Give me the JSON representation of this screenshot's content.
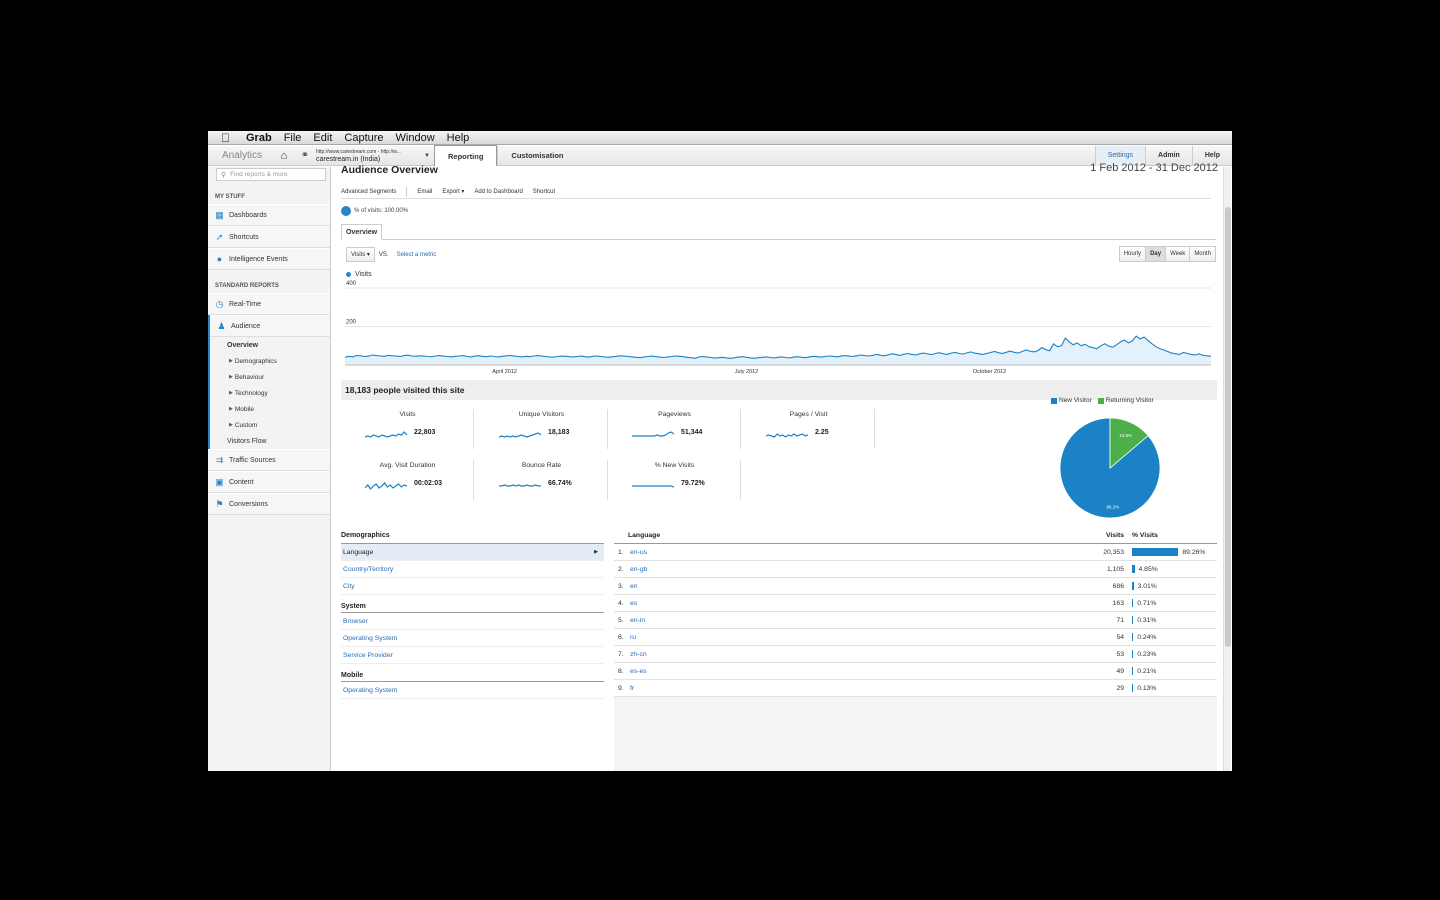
{
  "menubar": {
    "apple": "",
    "items": [
      "Grab",
      "File",
      "Edit",
      "Capture",
      "Window",
      "Help"
    ]
  },
  "header": {
    "brand": "Analytics",
    "account_url": "http://www.carestream.com - http://w...",
    "account_site": "carestream.in (India)",
    "tabs": [
      "Reporting",
      "Customisation"
    ],
    "right": [
      "Settings",
      "Admin",
      "Help"
    ]
  },
  "sidebar": {
    "search_placeholder": "Find reports & more",
    "my_stuff_heading": "MY STUFF",
    "my_stuff": [
      "Dashboards",
      "Shortcuts",
      "Intelligence Events"
    ],
    "standard_heading": "STANDARD REPORTS",
    "realtime": "Real-Time",
    "audience": "Audience",
    "audience_sub": [
      "Overview",
      "Demographics",
      "Behaviour",
      "Technology",
      "Mobile",
      "Custom",
      "Visitors Flow"
    ],
    "bottom": [
      "Traffic Sources",
      "Content",
      "Conversions"
    ]
  },
  "main": {
    "title": "Audience Overview",
    "date_range": "1 Feb 2012 - 31 Dec 2012",
    "toolbar": [
      "Advanced Segments",
      "Email",
      "Export ▾",
      "Add to Dashboard",
      "Shortcut"
    ],
    "segment_label": "% of visits: 100.00%",
    "tab": "Overview",
    "metric_select": "Visits",
    "vs": "VS.",
    "select_metric": "Select a metric",
    "granularity": [
      "Hourly",
      "Day",
      "Week",
      "Month"
    ],
    "legend": "Visits",
    "visited_text": "18,183 people visited this site"
  },
  "chart_data": {
    "type": "area",
    "series": [
      {
        "name": "Visits",
        "values": [
          40,
          45,
          42,
          50,
          48,
          44,
          46,
          52,
          49,
          47,
          45,
          50,
          48,
          46,
          44,
          49,
          51,
          47,
          45,
          48,
          46,
          44,
          43,
          47,
          49,
          46,
          44,
          42,
          45,
          47,
          49,
          44,
          42,
          46,
          48,
          45,
          43,
          47,
          44,
          42,
          45,
          48,
          50,
          46,
          44,
          42,
          45,
          43,
          47,
          49,
          46,
          44,
          42,
          41,
          44,
          46,
          45,
          43,
          42,
          44,
          46,
          43,
          41,
          45,
          47,
          44,
          42,
          40,
          43,
          45,
          48,
          46,
          44,
          42,
          40,
          38,
          42,
          44,
          46,
          43,
          41,
          39,
          42,
          44,
          47,
          45,
          43,
          40,
          38,
          35,
          42,
          44,
          41,
          39,
          36,
          38,
          40,
          37,
          35,
          38,
          41,
          43,
          40,
          37,
          35,
          38,
          40,
          42,
          39,
          37,
          40,
          42,
          39,
          37,
          41,
          43,
          40,
          38,
          42,
          45,
          43,
          41,
          44,
          47,
          45,
          42,
          46,
          49,
          46,
          44,
          48,
          52,
          49,
          47,
          50,
          55,
          51,
          48,
          53,
          58,
          54,
          50,
          56,
          60,
          55,
          52,
          58,
          62,
          57,
          54,
          60,
          64,
          58,
          55,
          62,
          66,
          60,
          57,
          63,
          68,
          62,
          58,
          55,
          60,
          65,
          70,
          64,
          60,
          66,
          72,
          66,
          62,
          70,
          78,
          72,
          68,
          75,
          90,
          80,
          74,
          110,
          95,
          100,
          140,
          120,
          105,
          115,
          100,
          108,
          95,
          90,
          85,
          100,
          110,
          98,
          92,
          105,
          120,
          130,
          115,
          125,
          150,
          135,
          145,
          128,
          110,
          95,
          85,
          78,
          70,
          62,
          58,
          55,
          65,
          60,
          55,
          52,
          58,
          50,
          48,
          45
        ]
      }
    ],
    "x_tick_labels": [
      "April 2012",
      "July 2012",
      "October 2012"
    ],
    "y_tick_labels": [
      "400",
      "200"
    ],
    "ylim": [
      0,
      400
    ],
    "grid": true
  },
  "metrics": [
    {
      "label": "Visits",
      "value": "22,803"
    },
    {
      "label": "Unique Visitors",
      "value": "18,183"
    },
    {
      "label": "Pageviews",
      "value": "51,344"
    },
    {
      "label": "Pages / Visit",
      "value": "2.25"
    },
    {
      "label": "Avg. Visit Duration",
      "value": "00:02:03"
    },
    {
      "label": "Bounce Rate",
      "value": "66.74%"
    },
    {
      "label": "% New Visits",
      "value": "79.72%"
    }
  ],
  "pie": {
    "legend": [
      "New Visitor",
      "Returning Visitor"
    ],
    "colors": [
      "#1b83c5",
      "#4cb04a"
    ],
    "values": [
      86.2,
      13.8
    ],
    "labels": [
      "86.2%",
      "13.8%"
    ]
  },
  "demographics": {
    "heading": "Demographics",
    "items": [
      "Language",
      "Country/Territory",
      "City"
    ],
    "system_heading": "System",
    "system_items": [
      "Browser",
      "Operating System",
      "Service Provider"
    ],
    "mobile_heading": "Mobile",
    "mobile_items": [
      "Operating System"
    ]
  },
  "language_table": {
    "headers": [
      "Language",
      "Visits",
      "% Visits"
    ],
    "rows": [
      {
        "n": "1.",
        "lang": "en-us",
        "visits": "20,353",
        "pct": "89.26%",
        "frac": 0.8926
      },
      {
        "n": "2.",
        "lang": "en-gb",
        "visits": "1,105",
        "pct": "4.85%",
        "frac": 0.0485
      },
      {
        "n": "3.",
        "lang": "en",
        "visits": "686",
        "pct": "3.01%",
        "frac": 0.0301
      },
      {
        "n": "4.",
        "lang": "es",
        "visits": "163",
        "pct": "0.71%",
        "frac": 0.0071
      },
      {
        "n": "5.",
        "lang": "en-in",
        "visits": "71",
        "pct": "0.31%",
        "frac": 0.0031
      },
      {
        "n": "6.",
        "lang": "ru",
        "visits": "54",
        "pct": "0.24%",
        "frac": 0.0024
      },
      {
        "n": "7.",
        "lang": "zh-cn",
        "visits": "53",
        "pct": "0.23%",
        "frac": 0.0023
      },
      {
        "n": "8.",
        "lang": "es-es",
        "visits": "49",
        "pct": "0.21%",
        "frac": 0.0021
      },
      {
        "n": "9.",
        "lang": "fr",
        "visits": "29",
        "pct": "0.13%",
        "frac": 0.0013
      }
    ]
  }
}
